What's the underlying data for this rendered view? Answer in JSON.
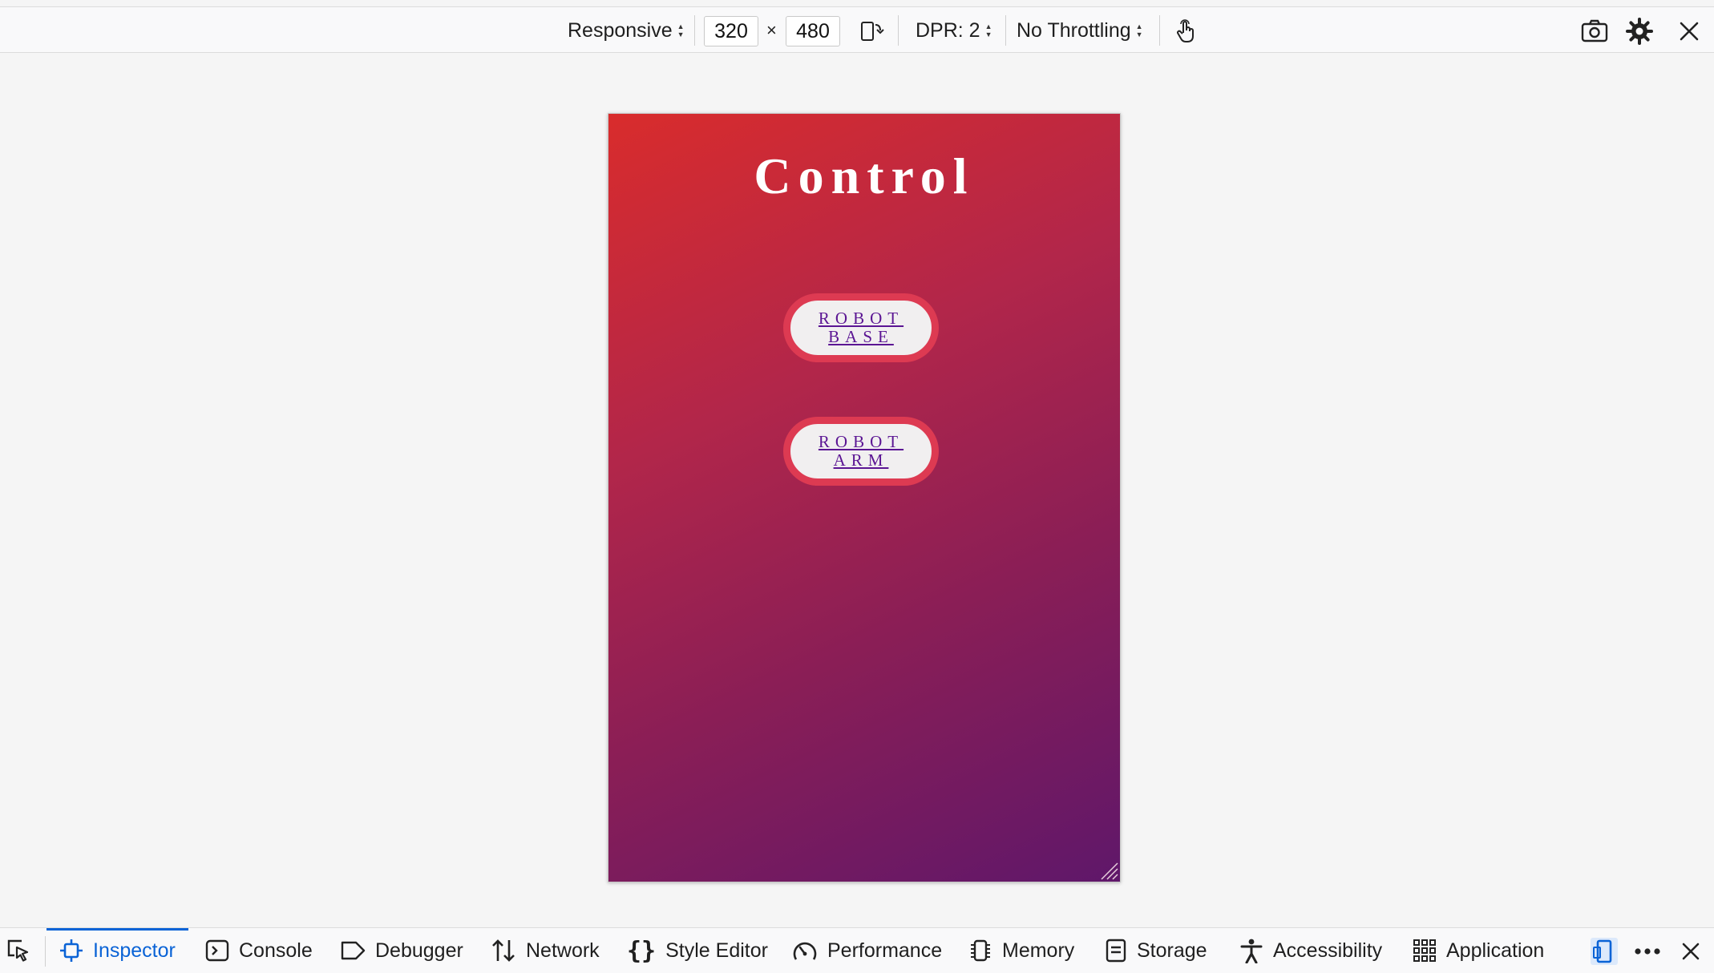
{
  "toolbar": {
    "device_mode": "Responsive",
    "width": "320",
    "times": "×",
    "height": "480",
    "dpr": "DPR: 2",
    "throttling": "No Throttling"
  },
  "page": {
    "title": "Control",
    "buttons": [
      {
        "line1": "ROBOT",
        "line2": "BASE"
      },
      {
        "line1": "ROBOT",
        "line2": "ARM"
      }
    ]
  },
  "devtools": {
    "tabs": [
      {
        "label": "Inspector",
        "icon": "inspector-icon",
        "selected": true
      },
      {
        "label": "Console",
        "icon": "console-icon"
      },
      {
        "label": "Debugger",
        "icon": "debugger-icon"
      },
      {
        "label": "Network",
        "icon": "network-icon"
      },
      {
        "label": "Style Editor",
        "icon": "style-editor-icon"
      },
      {
        "label": "Performance",
        "icon": "performance-icon"
      },
      {
        "label": "Memory",
        "icon": "memory-icon"
      },
      {
        "label": "Storage",
        "icon": "storage-icon"
      },
      {
        "label": "Accessibility",
        "icon": "accessibility-icon"
      },
      {
        "label": "Application",
        "icon": "application-icon"
      }
    ]
  },
  "colors": {
    "accent": "#0a63d6",
    "pill_border": "#dd3a52",
    "link": "#5b1593",
    "gradient_start": "#d92c2c",
    "gradient_end": "#5f176a"
  }
}
